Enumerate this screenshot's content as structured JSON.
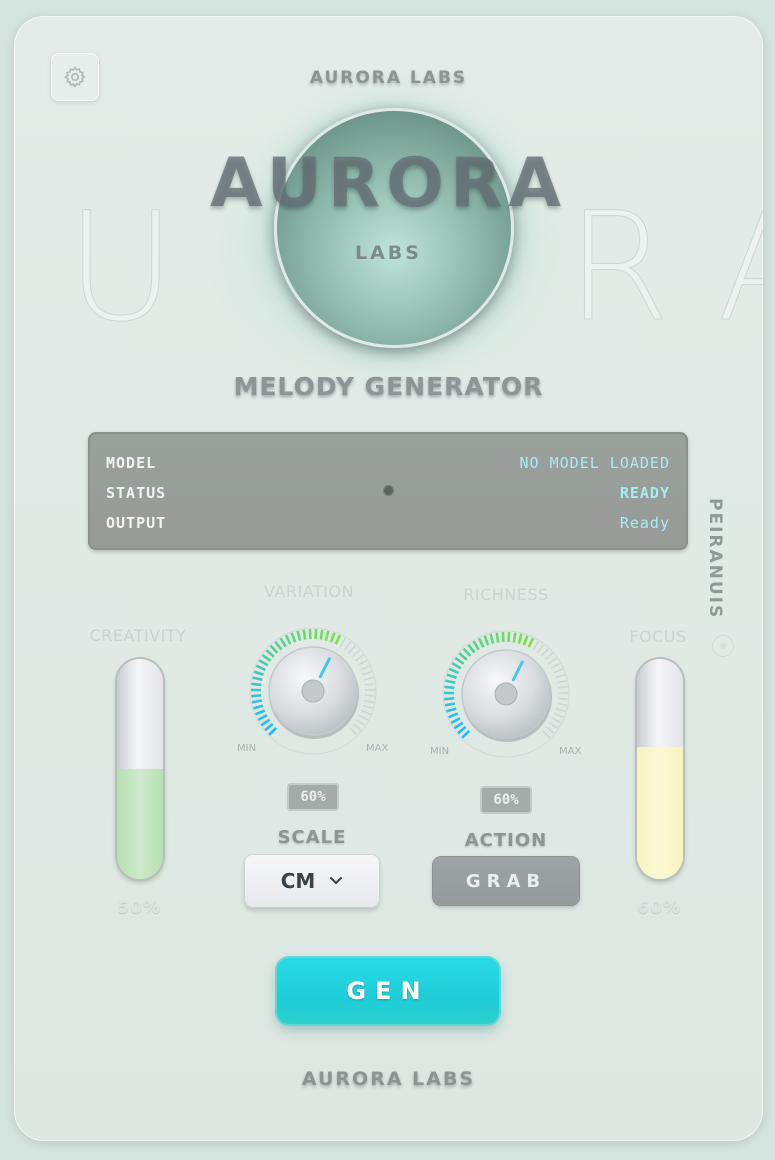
{
  "brand": {
    "top": "AURORA LABS",
    "title": "AURORA",
    "labs": "LABS",
    "bottom": "AURORA LABS",
    "bg_letters": [
      "U",
      "R",
      "A"
    ]
  },
  "subtitle": "MELODY GENERATOR",
  "display": {
    "rows": [
      {
        "key": "MODEL",
        "value": "NO MODEL LOADED"
      },
      {
        "key": "STATUS",
        "value": "READY"
      },
      {
        "key": "OUTPUT",
        "value": "Ready"
      }
    ]
  },
  "side_label": "PEIRANUIS",
  "controls": {
    "creativity": {
      "label": "CREATIVITY",
      "value_text": "50%",
      "level": 0.5,
      "fill_color": "#b6e0b2"
    },
    "variation": {
      "label": "VARIATION",
      "min": "MIN",
      "max": "MAX",
      "value_text": "60%",
      "level": 0.6
    },
    "richness": {
      "label": "RICHNESS",
      "min": "MIN",
      "max": "MAX",
      "value_text": "60%",
      "level": 0.6
    },
    "focus": {
      "label": "FOCUS",
      "value_text": "60%",
      "level": 0.6,
      "fill_color": "#f8f4bf"
    }
  },
  "scale": {
    "label": "SCALE",
    "value": "CM"
  },
  "action": {
    "label": "ACTION",
    "button": "GRAB"
  },
  "generate_button": "GEN",
  "colors": {
    "accent": "#22d4de",
    "knob_arc_start": "#1fb8ff",
    "knob_arc_end": "#7fe04a"
  },
  "icons": {
    "settings": "gear-icon",
    "scale_dropdown": "chevron-down-icon"
  }
}
